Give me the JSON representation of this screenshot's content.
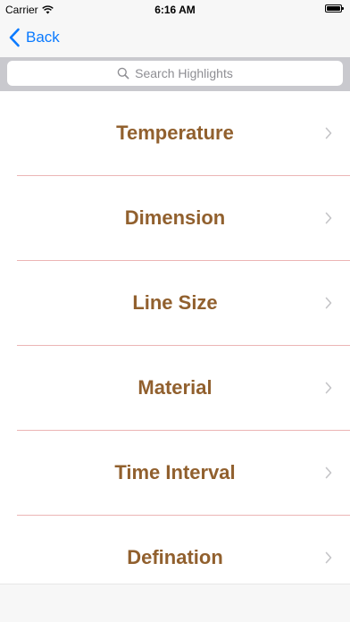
{
  "status_bar": {
    "carrier": "Carrier",
    "time": "6:16 AM",
    "icons": [
      "wifi-icon",
      "battery-icon"
    ]
  },
  "nav": {
    "back_label": "Back",
    "back_icon": "chevron-left-icon"
  },
  "search": {
    "placeholder": "Search Highlights",
    "icon": "search-icon"
  },
  "list": {
    "items": [
      {
        "label": "Temperature"
      },
      {
        "label": "Dimension"
      },
      {
        "label": "Line Size"
      },
      {
        "label": "Material"
      },
      {
        "label": "Time Interval"
      },
      {
        "label": "Defination"
      }
    ],
    "chevron_icon": "chevron-right-icon"
  },
  "colors": {
    "accent": "#0a7aff",
    "item_text": "#91602e",
    "separator": "#ecb5b5",
    "search_bar_bg": "#c9c9ce"
  }
}
